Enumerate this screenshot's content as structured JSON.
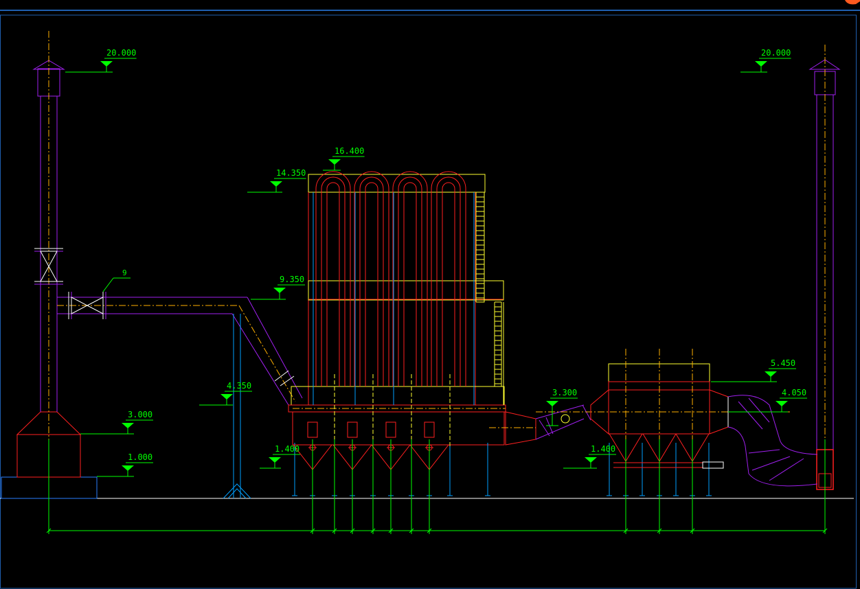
{
  "colors": {
    "background": "#000000",
    "border": "#1f5fb0",
    "level_marker": "#00ff00",
    "ductwork": "#a020f0",
    "steel": "#ff2020",
    "centerline": "#ffb000",
    "column": "#00a0ff",
    "ladder": "#ffff30",
    "ground": "#ffffff",
    "accent_logo": "#ff5a1f"
  },
  "elevations": {
    "stack_left_top": "20.000",
    "stack_right_top": "20.000",
    "filter_top": "16.400",
    "filter_upper": "14.350",
    "filter_mid": "9.350",
    "filter_walkway": "4.350",
    "stack_base": "3.000",
    "foundation": "1.000",
    "hopper_bottom_left": "1.400",
    "duct_inlet": "3.300",
    "hopper_bottom_right": "1.400",
    "precooler_top": "5.450",
    "precooler_outlet": "4.050"
  },
  "callouts": {
    "valve_tag": "9"
  }
}
